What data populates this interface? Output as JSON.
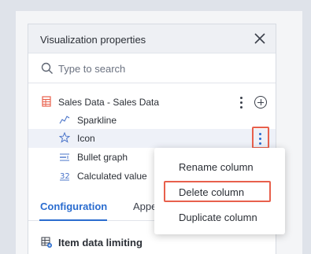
{
  "panel": {
    "title": "Visualization properties"
  },
  "search": {
    "placeholder": "Type to search",
    "value": ""
  },
  "tree": {
    "table_label": "Sales Data - Sales Data",
    "columns": [
      {
        "label": "Sparkline",
        "icon": "sparkline-icon"
      },
      {
        "label": "Icon",
        "icon": "star-icon"
      },
      {
        "label": "Bullet graph",
        "icon": "bullet-graph-icon"
      },
      {
        "label": "Calculated value",
        "icon": "calculated-value-icon"
      }
    ]
  },
  "tabs": [
    {
      "label": "Configuration",
      "active": true
    },
    {
      "label": "Appe",
      "active": false
    }
  ],
  "section": {
    "label": "Item data limiting"
  },
  "context_menu": {
    "items": [
      {
        "label": "Rename column"
      },
      {
        "label": "Delete column"
      },
      {
        "label": "Duplicate column"
      }
    ]
  },
  "colors": {
    "accent": "#2a6ccf",
    "highlight_box": "#e8604c",
    "table_icon": "#e8604c"
  }
}
